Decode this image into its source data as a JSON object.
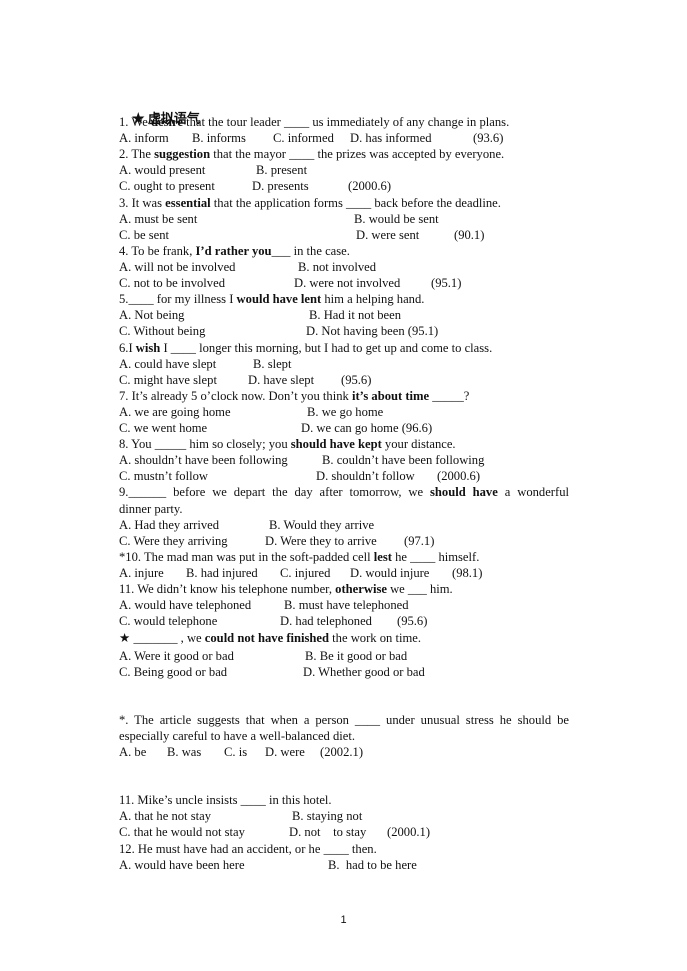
{
  "heading": {
    "star": "★",
    "title": "虚拟语气"
  },
  "questions": [
    {
      "lead": "1. We ",
      "bold": "desire",
      "tail": " that the tour leader ____ us immediately of any change in plans.",
      "options": [
        "A. inform",
        "B. informs",
        "C. informed",
        "D. has informed",
        "(93.6)"
      ]
    },
    {
      "lead": "2. The ",
      "bold": "suggestion",
      "tail": " that the mayor ____ the prizes was accepted by everyone.",
      "options": [
        "A. would present",
        "B. present",
        "C. ought to present",
        "D. presents",
        "(2000.6)"
      ]
    },
    {
      "lead": "3. It was ",
      "bold": "essential",
      "tail": " that the application forms ____ back before the deadline.",
      "options": [
        "A. must be sent",
        "B. would be sent",
        "C. be sent",
        "D. were sent",
        "(90.1)"
      ]
    },
    {
      "lead": "4. To be frank, ",
      "bold": "I’d rather you",
      "tail": "___ in the case.",
      "options": [
        "A. will not be involved",
        "B. not involved",
        "C. not to be involved",
        "D. were not involved",
        "(95.1)"
      ]
    },
    {
      "lead": "5.____ for my illness I ",
      "bold": "would have lent",
      "tail": " him a helping hand.",
      "options": [
        "A. Not being",
        "B. Had it not been",
        "C. Without being",
        "D. Not having been (95.1)"
      ]
    },
    {
      "lead": "6.I ",
      "bold": "wish",
      "tail": " I ____ longer this morning, but I had to get up and come to class.",
      "options": [
        "A. could have slept",
        "B. slept",
        "C. might have slept",
        "D. have slept",
        "(95.6)"
      ]
    },
    {
      "lead": "7. It’s already 5 o’clock now. Don’t you think ",
      "bold": "it’s about time",
      "tail": " _____?",
      "options": [
        "A. we are going home",
        "B. we go home",
        "C. we went home",
        "D. we can go home (96.6)"
      ]
    },
    {
      "lead": "8. You _____ him so closely; you ",
      "bold": "should have kept",
      "tail": " your distance.",
      "options": [
        "A. shouldn’t have been following",
        "B. couldn’t have been following",
        "C. mustn’t follow",
        "D. shouldn’t follow",
        "(2000.6)"
      ]
    },
    {
      "lead": "9.______ before we depart the day after tomorrow, we ",
      "bold": "should have",
      "tail": " a wonderful",
      "continuation": "dinner party.",
      "options": [
        "A. Had they arrived",
        "B. Would they arrive",
        "C. Were they arriving",
        "D. Were they to arrive",
        "(97.1)"
      ]
    },
    {
      "lead": "*10. The mad man was put in the soft-padded cell ",
      "bold": "lest",
      "tail": " he ____ himself.",
      "options": [
        "A. injure",
        "B. had injured",
        "C. injured",
        "D. would injure",
        "(98.1)"
      ]
    },
    {
      "lead": "11. We didn’t know his telephone number, ",
      "bold": "otherwise",
      "tail": " we ___ him.",
      "options": [
        "A. would have telephoned",
        "B. must have telephoned",
        "C. would telephone",
        "D. had telephoned",
        "(95.6)"
      ]
    },
    {
      "lead": "★ _______ , we ",
      "bold": "could not have finished",
      "tail": " the work on time.",
      "options": [
        "A. Were it good or bad",
        "B. Be it good or bad",
        "C. Being good or bad",
        "D. Whether good or bad"
      ]
    },
    {
      "lead": "*. The article suggests that when a person ____ under unusual stress he should be",
      "continuation": "especially careful to have a well-balanced diet.",
      "options": [
        "A. be",
        "B. was",
        "C. is",
        "D. were",
        "(2002.1)"
      ]
    },
    {
      "lead": "11. Mike’s uncle insists ____ in this hotel.",
      "options": [
        "A. that he not stay",
        "B. staying not",
        "C. that he would not stay",
        "D. not    to stay",
        "(2000.1)"
      ]
    },
    {
      "lead": "12. He must have had an accident, or he ____ then.",
      "options": [
        "A. would have been here",
        "B.  had to be here"
      ]
    }
  ],
  "page_number": "1"
}
